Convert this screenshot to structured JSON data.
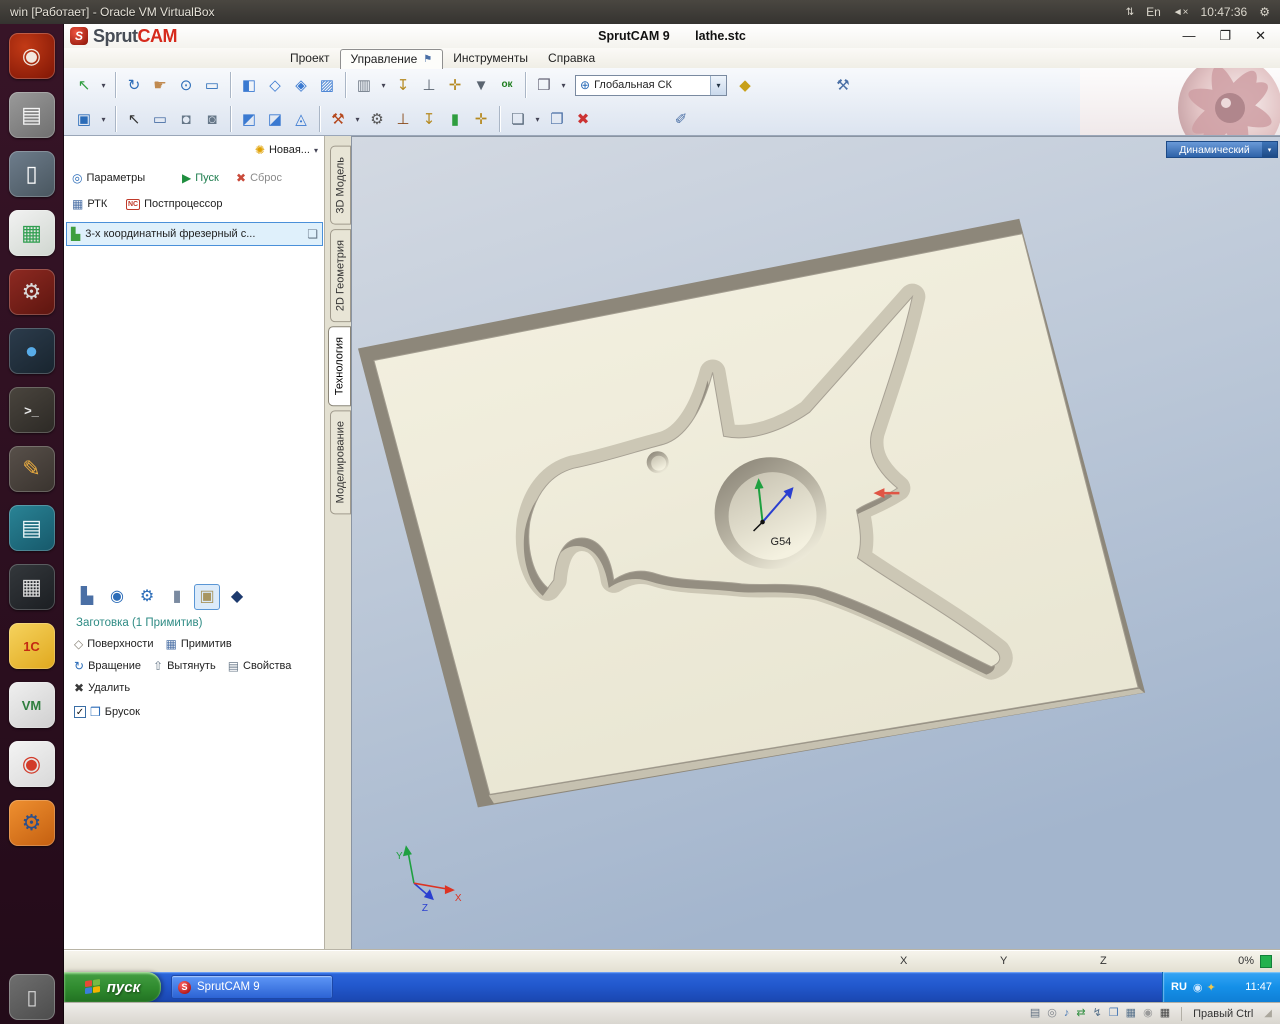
{
  "vbox": {
    "title": "win [Работает] - Oracle VM VirtualBox",
    "indicator_keyboard": "⇅",
    "lang": "En",
    "volume_icon": "◄×",
    "clock": "10:47:36",
    "session_icon": "⚙",
    "status_icons": [
      {
        "name": "hdd-status-icon",
        "glyph": "▤",
        "color": "#5f6f80"
      },
      {
        "name": "cd-status-icon",
        "glyph": "◎",
        "color": "#80858c"
      },
      {
        "name": "audio-status-icon",
        "glyph": "♪",
        "color": "#4a7ab5"
      },
      {
        "name": "network-status-icon",
        "glyph": "⇄",
        "color": "#2f8e3f"
      },
      {
        "name": "usb-status-icon",
        "glyph": "↯",
        "color": "#55708a"
      },
      {
        "name": "shared-folders-status-icon",
        "glyph": "❒",
        "color": "#4a7ab5"
      },
      {
        "name": "display-status-icon",
        "glyph": "▦",
        "color": "#55708a"
      },
      {
        "name": "video-capture-status-icon",
        "glyph": "◉",
        "color": "#9a9a9a"
      },
      {
        "name": "keyboard-status-icon",
        "glyph": "▦",
        "color": "#444444"
      }
    ],
    "host_key_label": "Правый Ctrl",
    "grip_icon": "◢"
  },
  "launcher": {
    "items": [
      {
        "name": "launcher-dash-home",
        "glyph": "◉",
        "bg": "radial-gradient(circle at 35% 30%, #c23a16, #7e1505)",
        "fg": "#f2e8df"
      },
      {
        "name": "launcher-files",
        "glyph": "▤",
        "bg": "linear-gradient(145deg,#9a9a9a,#6f6f6f)",
        "fg": "#f4f4f4"
      },
      {
        "name": "launcher-text-editor",
        "glyph": "▯",
        "bg": "linear-gradient(145deg,#6e7d8c,#49565f)",
        "fg": "#ffffff"
      },
      {
        "name": "launcher-libreoffice-calc",
        "glyph": "▦",
        "bg": "linear-gradient(145deg,#f2f2f2,#cfd6cf)",
        "fg": "#2f9e4f"
      },
      {
        "name": "launcher-system-tools",
        "glyph": "⚙",
        "bg": "linear-gradient(145deg,#8e2a22,#5d150f)",
        "fg": "#d9d9d9"
      },
      {
        "name": "launcher-web-browser",
        "glyph": "●",
        "bg": "linear-gradient(145deg,#2c3c4c,#18242e)",
        "fg": "#58ace8"
      },
      {
        "name": "launcher-terminal",
        "glyph": ">_",
        "small": true,
        "bg": "linear-gradient(145deg,#4a453e,#2c2925)",
        "fg": "#e8e8e8"
      },
      {
        "name": "launcher-notes",
        "glyph": "✎",
        "bg": "linear-gradient(145deg,#58504a,#39332e)",
        "fg": "#f0b040"
      },
      {
        "name": "launcher-documentation",
        "glyph": "▤",
        "bg": "linear-gradient(145deg,#2a8496,#16586a)",
        "fg": "#eaf6f8"
      },
      {
        "name": "launcher-calculator",
        "glyph": "▦",
        "bg": "linear-gradient(145deg,#34383c,#1b1e22)",
        "fg": "#dcdcdc"
      },
      {
        "name": "launcher-1c",
        "glyph": "1С",
        "small": true,
        "bg": "linear-gradient(145deg,#f6d35e,#e0a81e)",
        "fg": "#c42a12"
      },
      {
        "name": "launcher-vm-monitor",
        "glyph": "VM",
        "small": true,
        "bg": "linear-gradient(145deg,#f0f0f0,#cfcfcf)",
        "fg": "#2f7e3f"
      },
      {
        "name": "launcher-media-player",
        "glyph": "◉",
        "bg": "linear-gradient(145deg,#f4f4f4,#d8d8d8)",
        "fg": "#d23b2a"
      },
      {
        "name": "launcher-system-settings",
        "glyph": "⚙",
        "bg": "linear-gradient(145deg,#ef9030,#c45f10)",
        "fg": "#2c4f8a"
      }
    ],
    "trash": {
      "glyph": "▯"
    }
  },
  "sprutcam": {
    "logo_part1": "Sprut",
    "logo_part2": "CAM",
    "title_app": "SprutCAM 9",
    "title_file": "lathe.stc",
    "caret_glyph": "▾",
    "pin_glyph": "⚑",
    "window_buttons": {
      "minimize": "—",
      "restore": "❐",
      "close": "✕"
    },
    "menus": [
      {
        "name": "menu-project",
        "label": "Проект",
        "active": false
      },
      {
        "name": "menu-control",
        "label": "Управление",
        "active": true
      },
      {
        "name": "menu-tools",
        "label": "Инструменты",
        "active": false
      },
      {
        "name": "menu-help",
        "label": "Справка",
        "active": false
      }
    ],
    "toolbar_row1": [
      {
        "t": "btn",
        "name": "nav-up-button",
        "glyph": "↖",
        "color": "#2f9e3f",
        "caret": true
      },
      {
        "t": "sep"
      },
      {
        "t": "btn",
        "name": "rotate-view-button",
        "glyph": "↻",
        "color": "#2b6cb8"
      },
      {
        "t": "btn",
        "name": "pan-view-button",
        "glyph": "☛",
        "color": "#c08a50"
      },
      {
        "t": "btn",
        "name": "zoom-view-button",
        "glyph": "⊙",
        "color": "#2b6cb8"
      },
      {
        "t": "btn",
        "name": "zoom-window-button",
        "glyph": "▭",
        "color": "#2b6cb8"
      },
      {
        "t": "sep"
      },
      {
        "t": "btn",
        "name": "shaded-view-button",
        "glyph": "◧",
        "color": "#3b7ad1"
      },
      {
        "t": "btn",
        "name": "wireframe-view-button",
        "glyph": "◇",
        "color": "#3b7ad1"
      },
      {
        "t": "btn",
        "name": "translucent-view-button",
        "glyph": "◈",
        "color": "#3b7ad1"
      },
      {
        "t": "btn",
        "name": "mesh-view-button",
        "glyph": "▨",
        "color": "#3b7ad1"
      },
      {
        "t": "sep"
      },
      {
        "t": "btn",
        "name": "spindle-button",
        "glyph": "▥",
        "color": "#707a86",
        "caret": true
      },
      {
        "t": "btn",
        "name": "drill-cycle-button",
        "glyph": "↧",
        "color": "#b5891f"
      },
      {
        "t": "btn",
        "name": "pocket-cycle-button",
        "glyph": "⊥",
        "color": "#5a6470"
      },
      {
        "t": "btn",
        "name": "contour-cycle-button",
        "glyph": "✛",
        "color": "#b5891f"
      },
      {
        "t": "btn",
        "name": "finish-cycle-button",
        "glyph": "▼",
        "color": "#5a6470"
      },
      {
        "t": "btn",
        "name": "ok-button",
        "glyph": "ок",
        "small": true,
        "color": "#1f7e1f"
      },
      {
        "t": "sep"
      },
      {
        "t": "btn",
        "name": "layout-button",
        "glyph": "❒",
        "color": "#666677",
        "caret": true
      },
      {
        "t": "combo",
        "name": "coordinate-system-combo",
        "icon": "⊕",
        "label": "Глобальная СК"
      },
      {
        "t": "btn",
        "name": "cs-orientation-button",
        "glyph": "◆",
        "color": "#c8a018"
      },
      {
        "t": "gap"
      },
      {
        "t": "btn",
        "name": "hammer-button",
        "glyph": "⚒",
        "color": "#4a6fa5"
      }
    ],
    "toolbar_row2": [
      {
        "t": "btn",
        "name": "save-button",
        "glyph": "▣",
        "color": "#2b6cb8",
        "caret": true
      },
      {
        "t": "sep"
      },
      {
        "t": "btn",
        "name": "select-button",
        "glyph": "↖",
        "color": "#333333"
      },
      {
        "t": "btn",
        "name": "select-box-button",
        "glyph": "▭",
        "color": "#4a6fa5"
      },
      {
        "t": "btn",
        "name": "snapshot-button",
        "glyph": "◘",
        "color": "#667788"
      },
      {
        "t": "btn",
        "name": "snapshot-add-button",
        "glyph": "◙",
        "color": "#667788"
      },
      {
        "t": "sep"
      },
      {
        "t": "btn",
        "name": "section-view-button",
        "glyph": "◩",
        "color": "#3b7ad1"
      },
      {
        "t": "btn",
        "name": "measure-button",
        "glyph": "◪",
        "color": "#3b7ad1"
      },
      {
        "t": "btn",
        "name": "projection-button",
        "glyph": "◬",
        "color": "#3b7ad1"
      },
      {
        "t": "sep"
      },
      {
        "t": "btn",
        "name": "simulation-button",
        "glyph": "⚒",
        "color": "#b5481d",
        "caret": true
      },
      {
        "t": "btn",
        "name": "machine-button",
        "glyph": "⚙",
        "color": "#555555"
      },
      {
        "t": "btn",
        "name": "tool-holder-button",
        "glyph": "⊥",
        "color": "#8a4a1a"
      },
      {
        "t": "btn",
        "name": "drill-tool-button",
        "glyph": "↧",
        "color": "#b5891f"
      },
      {
        "t": "btn",
        "name": "turret-button",
        "glyph": "▮",
        "color": "#2f9e3f"
      },
      {
        "t": "btn",
        "name": "probe-button",
        "glyph": "✛",
        "color": "#b5891f"
      },
      {
        "t": "sep"
      },
      {
        "t": "btn",
        "name": "new-document-button",
        "glyph": "❏",
        "color": "#556677",
        "caret": true
      },
      {
        "t": "btn",
        "name": "export-image-button",
        "glyph": "❐",
        "color": "#4a6fa5"
      },
      {
        "t": "btn",
        "name": "delete-operation-button",
        "glyph": "✖",
        "color": "#cc3333"
      },
      {
        "t": "gap"
      },
      {
        "t": "btn",
        "name": "fastener-button",
        "glyph": "✐",
        "color": "#4a6fa5"
      }
    ],
    "tabs": [
      {
        "name": "tab-3d-model",
        "label": "3D Модель",
        "active": false
      },
      {
        "name": "tab-2d-geometry",
        "label": "2D Геометрия",
        "active": false
      },
      {
        "name": "tab-technology",
        "label": "Технология",
        "active": true
      },
      {
        "name": "tab-modeling",
        "label": "Моделирование",
        "active": false
      }
    ],
    "project_panel": {
      "new_label": "Новая...",
      "params_label": "Параметры",
      "run_label": "Пуск",
      "reset_label": "Сброс",
      "rtk_label": "РТК",
      "post_label": "Постпроцессор",
      "operation_label": "3-х координатный фрезерный с...",
      "icons": {
        "new": "✺",
        "params": "◎",
        "run": "▶",
        "reset": "✖",
        "rtk": "▦",
        "post_badge": "NC",
        "operation": "▙",
        "doc": "❏",
        "surfaces": "◇",
        "primitive": "▦",
        "rotation": "↻",
        "extrude": "⇧",
        "properties": "▤",
        "delete": "✖",
        "check": "✓",
        "box": "❒"
      },
      "model_icons": [
        {
          "name": "machine-icon",
          "glyph": "▙",
          "color": "#4a6fa5"
        },
        {
          "name": "model-icon",
          "glyph": "◉",
          "color": "#2b6cb8"
        },
        {
          "name": "setup-gear-icon",
          "glyph": "⚙",
          "color": "#2b6cb8"
        },
        {
          "name": "fixture-icon",
          "glyph": "▮",
          "color": "#7a8aa0"
        },
        {
          "name": "workpiece-icon",
          "glyph": "▣",
          "color": "#a89560",
          "selected": true
        },
        {
          "name": "part-icon",
          "glyph": "◆",
          "color": "#1d3a6e"
        }
      ],
      "workpiece_header": "Заготовка  (1 Примитив)",
      "btn_surfaces": "Поверхности",
      "btn_primitive": "Примитив",
      "btn_rotation": "Вращение",
      "btn_extrude": "Вытянуть",
      "btn_properties": "Свойства",
      "btn_delete": "Удалить",
      "checkbox_label": "Брусок"
    },
    "viewport": {
      "view_mode": "Динамический",
      "wcs_label": "G54",
      "axis_x": "X",
      "axis_y": "Y",
      "axis_z": "Z"
    },
    "statusbar": {
      "x": "X",
      "y": "Y",
      "z": "Z",
      "progress": "0%"
    },
    "taskbar": {
      "start_label": "пуск",
      "task_label": "SprutCAM 9",
      "task_icon_letter": "S",
      "flag_colors": [
        "#e64a36",
        "#77bb44",
        "#3a7edb",
        "#f4b400"
      ],
      "tray_lang": "RU",
      "tray_icons": [
        {
          "name": "tray-update-icon",
          "glyph": "◉",
          "color": "#cfe8ff"
        },
        {
          "name": "tray-security-icon",
          "glyph": "✦",
          "color": "#f2c84b"
        }
      ],
      "tray_clock": "11:47"
    }
  }
}
